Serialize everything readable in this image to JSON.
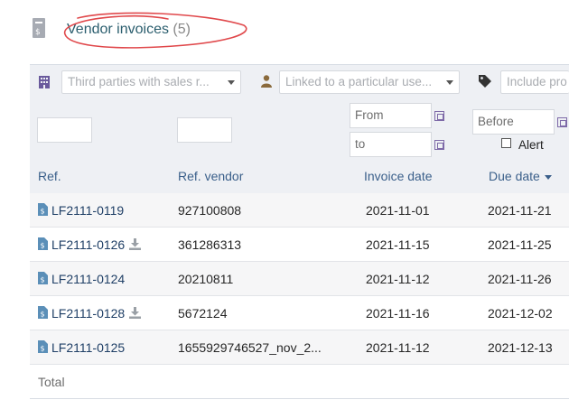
{
  "page": {
    "title": "Vendor invoices",
    "count": "(5)"
  },
  "filters": {
    "thirdparty_placeholder": "Third parties with sales r...",
    "user_placeholder": "Linked to a particular use...",
    "tag_placeholder": "Include pro",
    "date_from_placeholder": "From",
    "date_to_placeholder": "to",
    "due_before_placeholder": "Before",
    "alert_label": "Alert"
  },
  "columns": {
    "ref": "Ref.",
    "ref_vendor": "Ref. vendor",
    "invoice_date": "Invoice date",
    "due_date": "Due date"
  },
  "rows": [
    {
      "ref": "LF2111-0119",
      "ref_vendor": "927100808",
      "invoice_date": "2021-11-01",
      "due_date": "2021-11-21",
      "has_file": false
    },
    {
      "ref": "LF2111-0126",
      "ref_vendor": "361286313",
      "invoice_date": "2021-11-15",
      "due_date": "2021-11-25",
      "has_file": true
    },
    {
      "ref": "LF2111-0124",
      "ref_vendor": "20210811",
      "invoice_date": "2021-11-12",
      "due_date": "2021-11-26",
      "has_file": false
    },
    {
      "ref": "LF2111-0128",
      "ref_vendor": "5672124",
      "invoice_date": "2021-11-16",
      "due_date": "2021-12-02",
      "has_file": true
    },
    {
      "ref": "LF2111-0125",
      "ref_vendor": "1655929746527_nov_2...",
      "invoice_date": "2021-11-12",
      "due_date": "2021-12-13",
      "has_file": false
    }
  ],
  "footer": {
    "total_label": "Total"
  },
  "colors": {
    "link": "#1f3f66",
    "header_text": "#3a5f8a",
    "title": "#2b5e6e",
    "annotation": "#e0484b"
  }
}
